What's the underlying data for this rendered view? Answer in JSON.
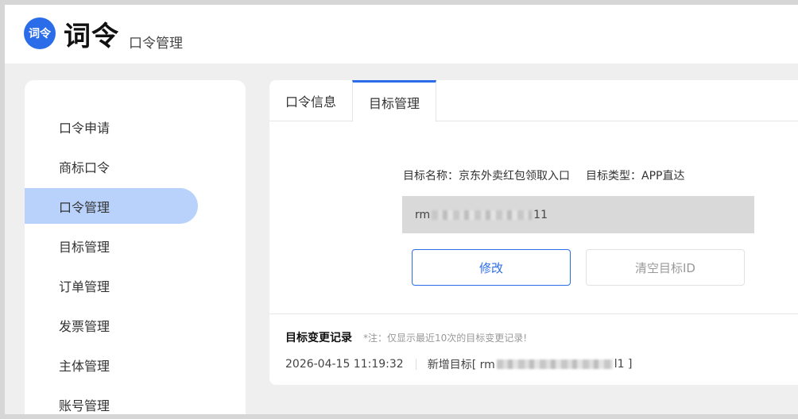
{
  "header": {
    "logo_text": "词令",
    "brand": "词令",
    "subtitle": "口令管理",
    "accent": "#2b6de8"
  },
  "sidebar": {
    "items": [
      {
        "label": "口令申请"
      },
      {
        "label": "商标口令"
      },
      {
        "label": "口令管理",
        "active": true
      },
      {
        "label": "目标管理"
      },
      {
        "label": "订单管理"
      },
      {
        "label": "发票管理"
      },
      {
        "label": "主体管理"
      },
      {
        "label": "账号管理"
      }
    ],
    "active_color": "#b9d2fb"
  },
  "tabs": [
    {
      "label": "口令信息"
    },
    {
      "label": "目标管理",
      "active": true
    }
  ],
  "target": {
    "name_label": "目标名称：",
    "name_value": "京东外卖红包领取入口",
    "type_label": "目标类型：",
    "type_value": "APP直达",
    "id_prefix": "rm",
    "id_suffix": "11"
  },
  "buttons": {
    "edit": "修改",
    "clear": "清空目标ID"
  },
  "log": {
    "title": "目标变更记录",
    "note": "*注：仅显示最近10次的目标变更记录!",
    "entries": [
      {
        "time": "2026-04-15 11:19:32",
        "action_prefix": "新增目标[ rm",
        "action_suffix": "l1 ]"
      }
    ]
  }
}
